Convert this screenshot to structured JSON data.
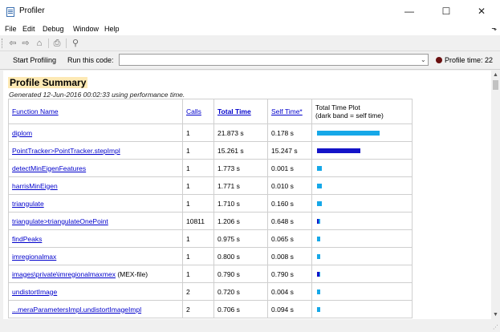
{
  "window": {
    "title": "Profiler",
    "minimize": "—",
    "maximize": "☐",
    "close": "✕"
  },
  "menu": {
    "items": [
      "File",
      "Edit",
      "Debug",
      "Window",
      "Help"
    ],
    "overflow": "⬎"
  },
  "toolbar": {
    "back": "⇦",
    "forward": "⇨",
    "home": "⌂",
    "print": "⎙",
    "find": "⚲"
  },
  "runbar": {
    "start_profiling": "Start Profiling",
    "run_this_code": "Run this code:",
    "input_value": "",
    "profile_time": "Profile time: 22"
  },
  "summary": {
    "title": "Profile Summary",
    "generated": "Generated 12-Jun-2016 00:02:33 using performance time.",
    "headers": {
      "function_name": "Function Name",
      "calls": "Calls",
      "total_time": "Total Time",
      "self_time": "Self Time*",
      "plot_line1": "Total Time Plot",
      "plot_line2": "(dark band = self time)"
    },
    "rows": [
      {
        "name": "diplom",
        "suffix": "",
        "calls": "1",
        "total": "21.873 s",
        "self": "0.178 s",
        "total_s": 21.873,
        "self_s": 0.178
      },
      {
        "name": "PointTracker>PointTracker.stepImpl",
        "suffix": "",
        "calls": "1",
        "total": "15.261 s",
        "self": "15.247 s",
        "total_s": 15.261,
        "self_s": 15.247
      },
      {
        "name": "detectMinEigenFeatures",
        "suffix": "",
        "calls": "1",
        "total": "1.773 s",
        "self": "0.001 s",
        "total_s": 1.773,
        "self_s": 0.001
      },
      {
        "name": "harrisMinEigen",
        "suffix": "",
        "calls": "1",
        "total": "1.771 s",
        "self": "0.010 s",
        "total_s": 1.771,
        "self_s": 0.01
      },
      {
        "name": "triangulate",
        "suffix": "",
        "calls": "1",
        "total": "1.710 s",
        "self": "0.160 s",
        "total_s": 1.71,
        "self_s": 0.16
      },
      {
        "name": "triangulate>triangulateOnePoint",
        "suffix": "",
        "calls": "10811",
        "total": "1.206 s",
        "self": "0.648 s",
        "total_s": 1.206,
        "self_s": 0.648
      },
      {
        "name": "findPeaks",
        "suffix": "",
        "calls": "1",
        "total": "0.975 s",
        "self": "0.065 s",
        "total_s": 0.975,
        "self_s": 0.065
      },
      {
        "name": "imregionalmax",
        "suffix": "",
        "calls": "1",
        "total": "0.800 s",
        "self": "0.008 s",
        "total_s": 0.8,
        "self_s": 0.008
      },
      {
        "name": "images\\private\\imregionalmaxmex",
        "suffix": " (MEX-file)",
        "calls": "1",
        "total": "0.790 s",
        "self": "0.790 s",
        "total_s": 0.79,
        "self_s": 0.79
      },
      {
        "name": "undistortImage",
        "suffix": "",
        "calls": "2",
        "total": "0.720 s",
        "self": "0.004 s",
        "total_s": 0.72,
        "self_s": 0.004
      },
      {
        "name": "...meraParametersImpl.undistortImageImpl",
        "suffix": "",
        "calls": "2",
        "total": "0.706 s",
        "self": "0.094 s",
        "total_s": 0.706,
        "self_s": 0.094
      }
    ]
  },
  "colors": {
    "bar_total": "#16a8e8",
    "bar_self": "#1414c8",
    "link": "#0000cc",
    "title_highlight": "#fde9b4"
  }
}
